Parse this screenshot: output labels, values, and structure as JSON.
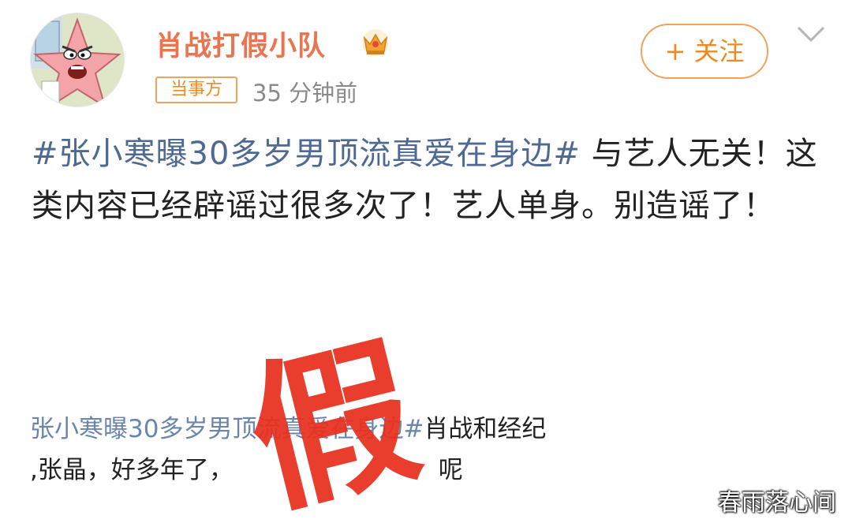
{
  "post": {
    "username": "肖战打假小队",
    "badge": "当事方",
    "time": "35 分钟前",
    "follow_label": "+ 关注",
    "hashtag": "#张小寒曝30多岁男顶流真爱在身边#",
    "text": " 与艺人无关！这类内容已经辟谣过很多次了！艺人单身。别造谣了！"
  },
  "embedded_fragment": {
    "line1_hashtag": "张小寒曝30多岁男顶流真爱在身边#",
    "line1_text": "肖战和经纪",
    "line2_text": ",张晶，好多年了，",
    "line2_tail": "呢"
  },
  "stamp": {
    "text": "假"
  },
  "watermark": {
    "text": "春雨落心间"
  },
  "colors": {
    "username": "#eb7350",
    "badge": "#f08a1e",
    "hashtag": "#4e6a93",
    "stamp": "#e8301e"
  },
  "icons": {
    "avatar": "patrick-star-avatar",
    "verified": "crown-icon",
    "menu": "chevron-down-icon"
  }
}
